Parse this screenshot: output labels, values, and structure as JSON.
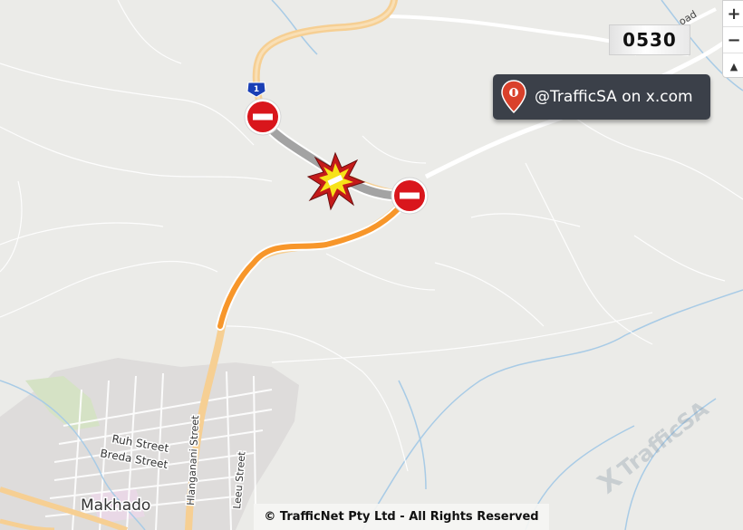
{
  "time_badge": "0530",
  "handle_box": {
    "text": "@TrafficSA on x.com",
    "icon": "location-pin-icon"
  },
  "zoom": {
    "in_label": "+",
    "out_label": "−",
    "reset_label": "▲"
  },
  "copyright": "© TrafficNet Pty Ltd - All Rights Reserved",
  "watermark": {
    "logo": "X",
    "text": "TrafficSA"
  },
  "map": {
    "route_shield": "1",
    "labels": {
      "town": "Makhado",
      "ruh": "Ruh Street",
      "breda": "Breda Street",
      "hlanganani": "Hlanganani Street",
      "leeu": "Leeu Street",
      "road_partial": "oad"
    },
    "markers": {
      "closure_icon": "no-entry-icon",
      "incident_icon": "crash-icon"
    },
    "colors": {
      "closed_road": "#a3a3a3",
      "congestion": "#f7962a",
      "closure_red": "#d9161c",
      "crash_red": "#c41a1a",
      "crash_yellow": "#f7e318",
      "road_major": "#f6cf93",
      "river": "#a8cbe6"
    }
  }
}
